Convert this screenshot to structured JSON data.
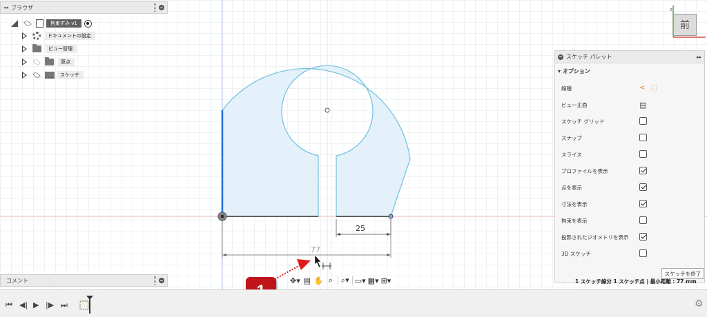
{
  "browser": {
    "title": "ブラウザ",
    "root_label": "拘束ずみ v1",
    "items": [
      {
        "label": "ドキュメントの設定",
        "icon": "gear-icon"
      },
      {
        "label": "ビュー管理",
        "icon": "folder-icon"
      },
      {
        "label": "原点",
        "icon": "folder-icon"
      },
      {
        "label": "スケッチ",
        "icon": "sketch-icon"
      }
    ]
  },
  "comments": {
    "title": "コメント"
  },
  "palette": {
    "title": "スケッチ パレット",
    "section": "オプション",
    "rows": [
      {
        "label": "線種",
        "control": "linetype-icons"
      },
      {
        "label": "ビュー正面",
        "control": "look-at-icon"
      },
      {
        "label": "スケッチ グリッド",
        "control": "checkbox",
        "checked": false
      },
      {
        "label": "スナップ",
        "control": "checkbox",
        "checked": false
      },
      {
        "label": "スライス",
        "control": "checkbox",
        "checked": false
      },
      {
        "label": "プロファイルを表示",
        "control": "checkbox",
        "checked": true
      },
      {
        "label": "点を表示",
        "control": "checkbox",
        "checked": true
      },
      {
        "label": "寸法を表示",
        "control": "checkbox",
        "checked": true
      },
      {
        "label": "拘束を表示",
        "control": "checkbox",
        "checked": false
      },
      {
        "label": "投影されたジオメトリを表示",
        "control": "checkbox",
        "checked": true
      },
      {
        "label": "3D スケッチ",
        "control": "checkbox",
        "checked": false
      }
    ],
    "finish_button": "スケッチを終了",
    "status": "1 スケッチ線分 1 スケッチ点 | 最小距離 : 77 mm"
  },
  "viewcube": {
    "face_label": "前"
  },
  "dimensions": {
    "small": "25",
    "large": "77"
  },
  "callout": {
    "number": "1"
  },
  "colors": {
    "sketch_line": "#6fc0dc",
    "profile_fill": "#e4f1fa",
    "selected_line": "#1e6ee0",
    "badge": "#c0141b"
  }
}
